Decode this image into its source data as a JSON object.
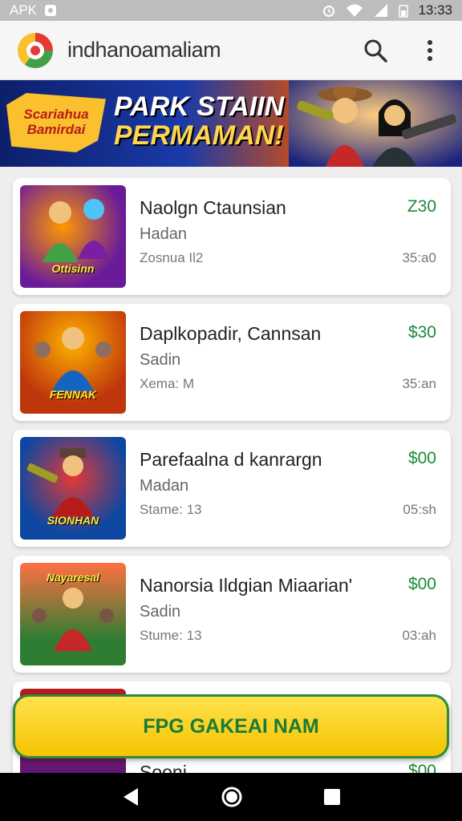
{
  "status_bar": {
    "left_text": "APK",
    "time": "13:33",
    "icons": [
      "lock-icon",
      "alarm-icon",
      "wifi-icon",
      "signal-icon",
      "battery-icon"
    ]
  },
  "app_bar": {
    "title": "indhanoamaliam",
    "icons": [
      "search-icon",
      "more-vert-icon"
    ]
  },
  "banner": {
    "badge_line1": "Scariahua",
    "badge_line2": "Bamirdai",
    "headline_line1": "PARK STAIIN",
    "headline_line2": "PERMAMAN!"
  },
  "items": [
    {
      "title": "Naolgn Ctaunsian",
      "subtitle": "Hadan",
      "meta": "Zosnua Il2",
      "price": "Z30",
      "time": "35:a0",
      "thumb_label": "Ottisinn",
      "thumb_colors": [
        "#6a1b9a",
        "#ff9800"
      ]
    },
    {
      "title": "Daplkopadir, Cannsan",
      "subtitle": "Sadin",
      "meta": "Xema: M",
      "price": "$30",
      "time": "35:an",
      "thumb_label": "FENNAK",
      "thumb_colors": [
        "#bf360c",
        "#ffb300"
      ]
    },
    {
      "title": "Parefaalna d kanrargn",
      "subtitle": "Madan",
      "meta": "Stame: 13",
      "price": "$00",
      "time": "05:sh",
      "thumb_label": "SIONHAN",
      "thumb_colors": [
        "#0d47a1",
        "#e53935"
      ]
    },
    {
      "title": "Nanorsia Ildgian Miaarian'",
      "subtitle": "Sadin",
      "meta": "Stume: 13",
      "price": "$00",
      "time": "03:ah",
      "thumb_label": "Nayaresal",
      "thumb_colors": [
        "#2e7d32",
        "#ff7043"
      ]
    }
  ],
  "partial_item": {
    "title": "Sooni",
    "price": "$00"
  },
  "cta": {
    "label": "FPG GAKEAI NAM"
  },
  "navbar": {
    "icons": [
      "back-icon",
      "home-icon",
      "recents-icon"
    ]
  }
}
